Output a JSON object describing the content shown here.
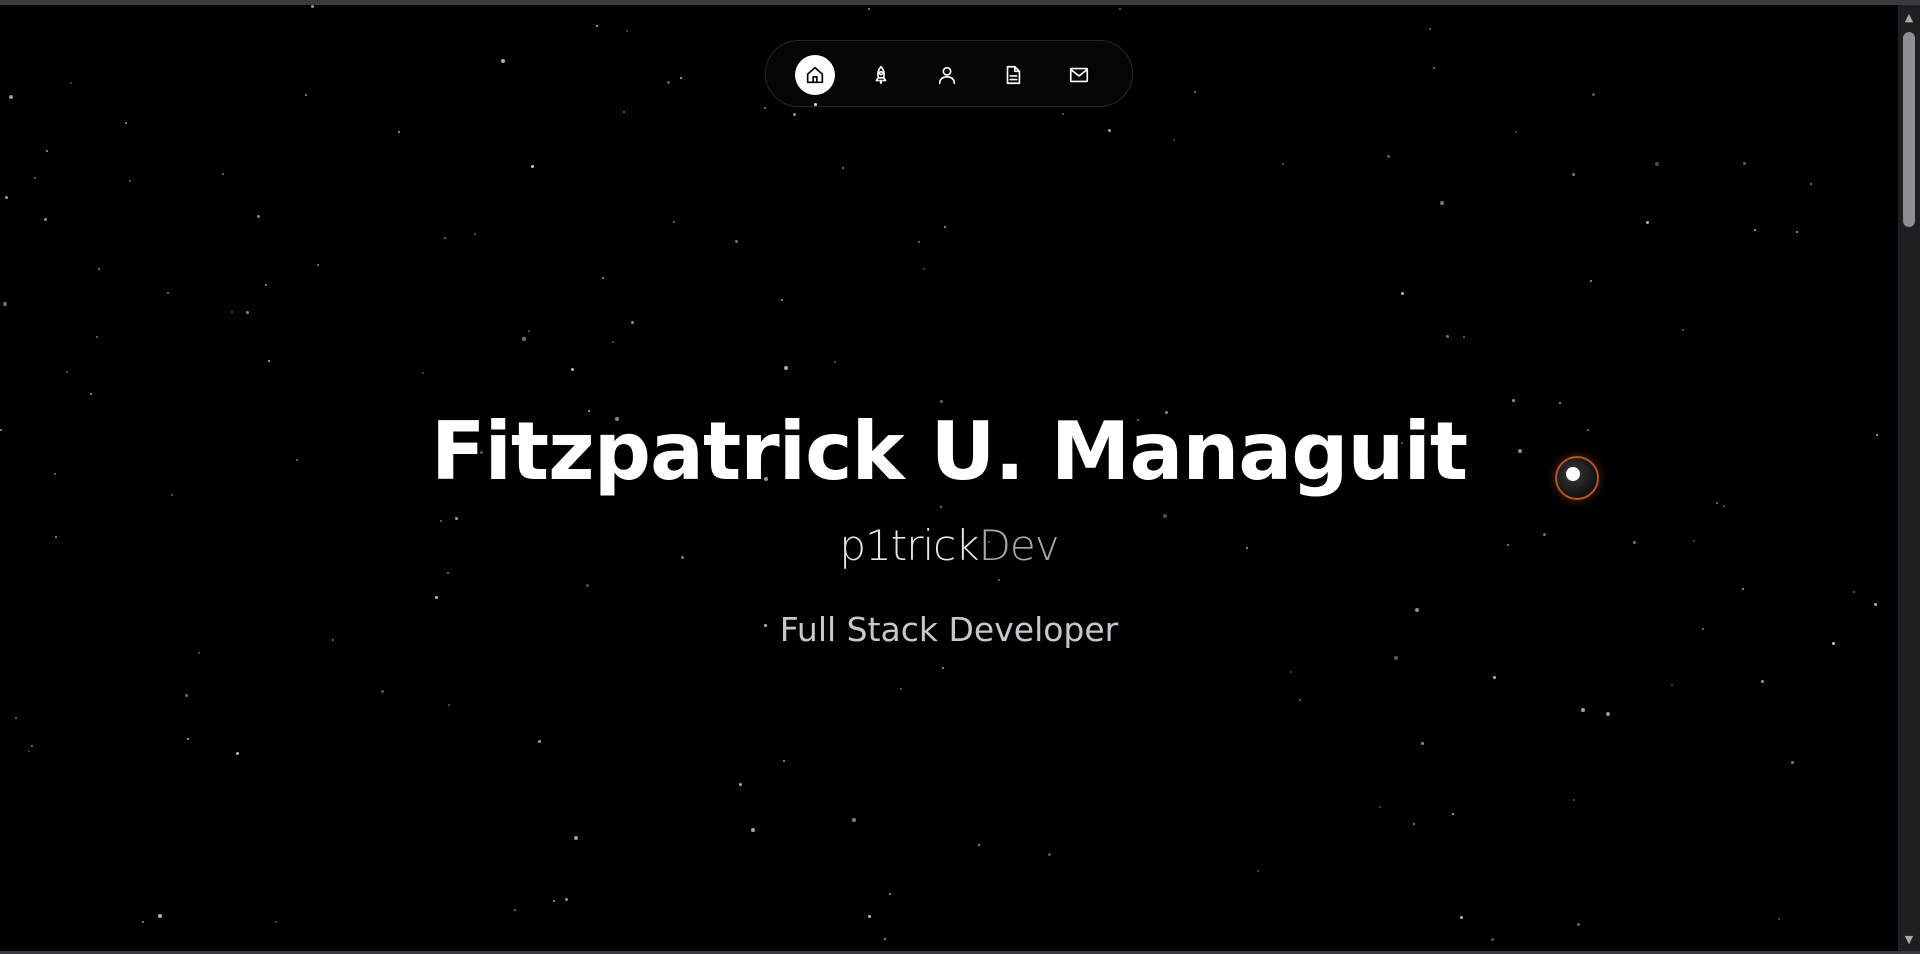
{
  "nav": {
    "items": [
      {
        "icon": "home-icon",
        "label": "Home",
        "active": true
      },
      {
        "icon": "rocket-icon",
        "label": "Projects",
        "active": false
      },
      {
        "icon": "user-icon",
        "label": "About",
        "active": false
      },
      {
        "icon": "document-icon",
        "label": "Resume",
        "active": false
      },
      {
        "icon": "mail-icon",
        "label": "Contact",
        "active": false
      }
    ]
  },
  "hero": {
    "name": "Fitzpatrick U. Managuit",
    "handle_prefix": "p1trick",
    "handle_suffix": "Dev",
    "role": "Full Stack Developer"
  },
  "colors": {
    "background": "#000000",
    "text_primary": "#ffffff",
    "text_secondary": "#c8c8cc",
    "orb_ring": "#b65223"
  },
  "scrollbar": {
    "up_glyph": "▲",
    "down_glyph": "▼"
  }
}
